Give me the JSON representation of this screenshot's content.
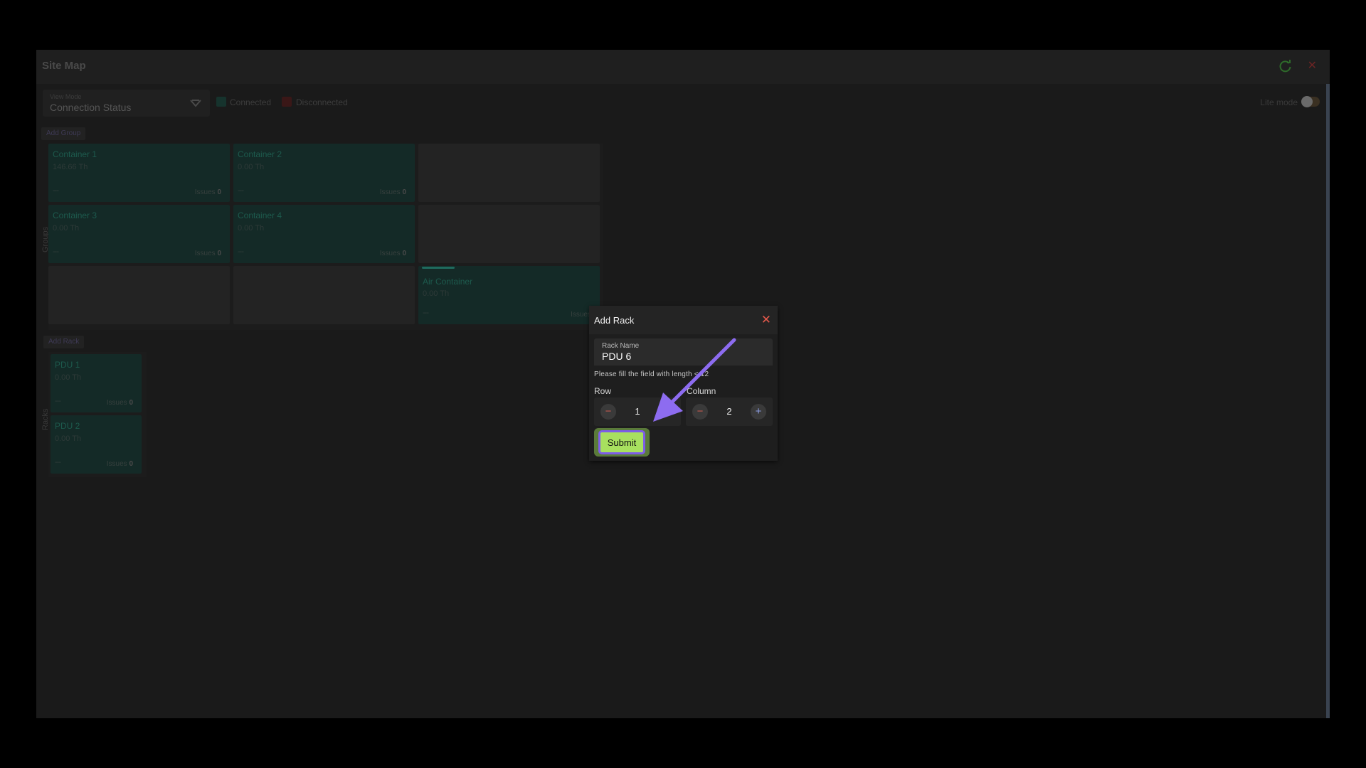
{
  "window": {
    "title": "Site Map",
    "refresh_icon": "refresh-icon",
    "close_icon": "close-icon"
  },
  "toolbar": {
    "view_mode_label": "View Mode",
    "view_mode_value": "Connection Status",
    "legend": [
      {
        "label": "Connected",
        "color": "#16332d"
      },
      {
        "label": "Disconnected",
        "color": "#3a1717"
      }
    ],
    "lite_mode_label": "Lite mode"
  },
  "groups": {
    "add_button": "Add Group",
    "side_label": "Groups",
    "tiles": [
      {
        "name": "Container 1",
        "value": "146.66 Th",
        "dash": "---",
        "issues_label": "Issues",
        "issues": "0"
      },
      {
        "name": "Container 2",
        "value": "0.00 Th",
        "dash": "---",
        "issues_label": "Issues",
        "issues": "0"
      },
      {
        "name": "Container 3",
        "value": "0.00 Th",
        "dash": "---",
        "issues_label": "Issues",
        "issues": "0"
      },
      {
        "name": "Container 4",
        "value": "0.00 Th",
        "dash": "---",
        "issues_label": "Issues",
        "issues": "0"
      },
      {
        "name": "Air Container",
        "value": "0.00 Th",
        "dash": "---",
        "issues_label": "Issues",
        "issues": ""
      }
    ]
  },
  "racks": {
    "add_button": "Add Rack",
    "side_label": "Racks",
    "tiles": [
      {
        "name": "PDU 1",
        "value": "0.00 Th",
        "dash": "---",
        "issues_label": "Issues",
        "issues": "0"
      },
      {
        "name": "PDU 2",
        "value": "0.00 Th",
        "dash": "---",
        "issues_label": "Issues",
        "issues": "0"
      }
    ]
  },
  "modal": {
    "title": "Add Rack",
    "rack_name_label": "Rack Name",
    "rack_name_value": "PDU 6",
    "helper": "Please fill the field with length < 12",
    "row_label": "Row",
    "row_value": "1",
    "column_label": "Column",
    "column_value": "2",
    "minus_symbol": "−",
    "plus_symbol": "+",
    "close_symbol": "✕",
    "submit_label": "Submit",
    "accent": "#7d5ce8",
    "submit_color": "#a8e05f"
  }
}
